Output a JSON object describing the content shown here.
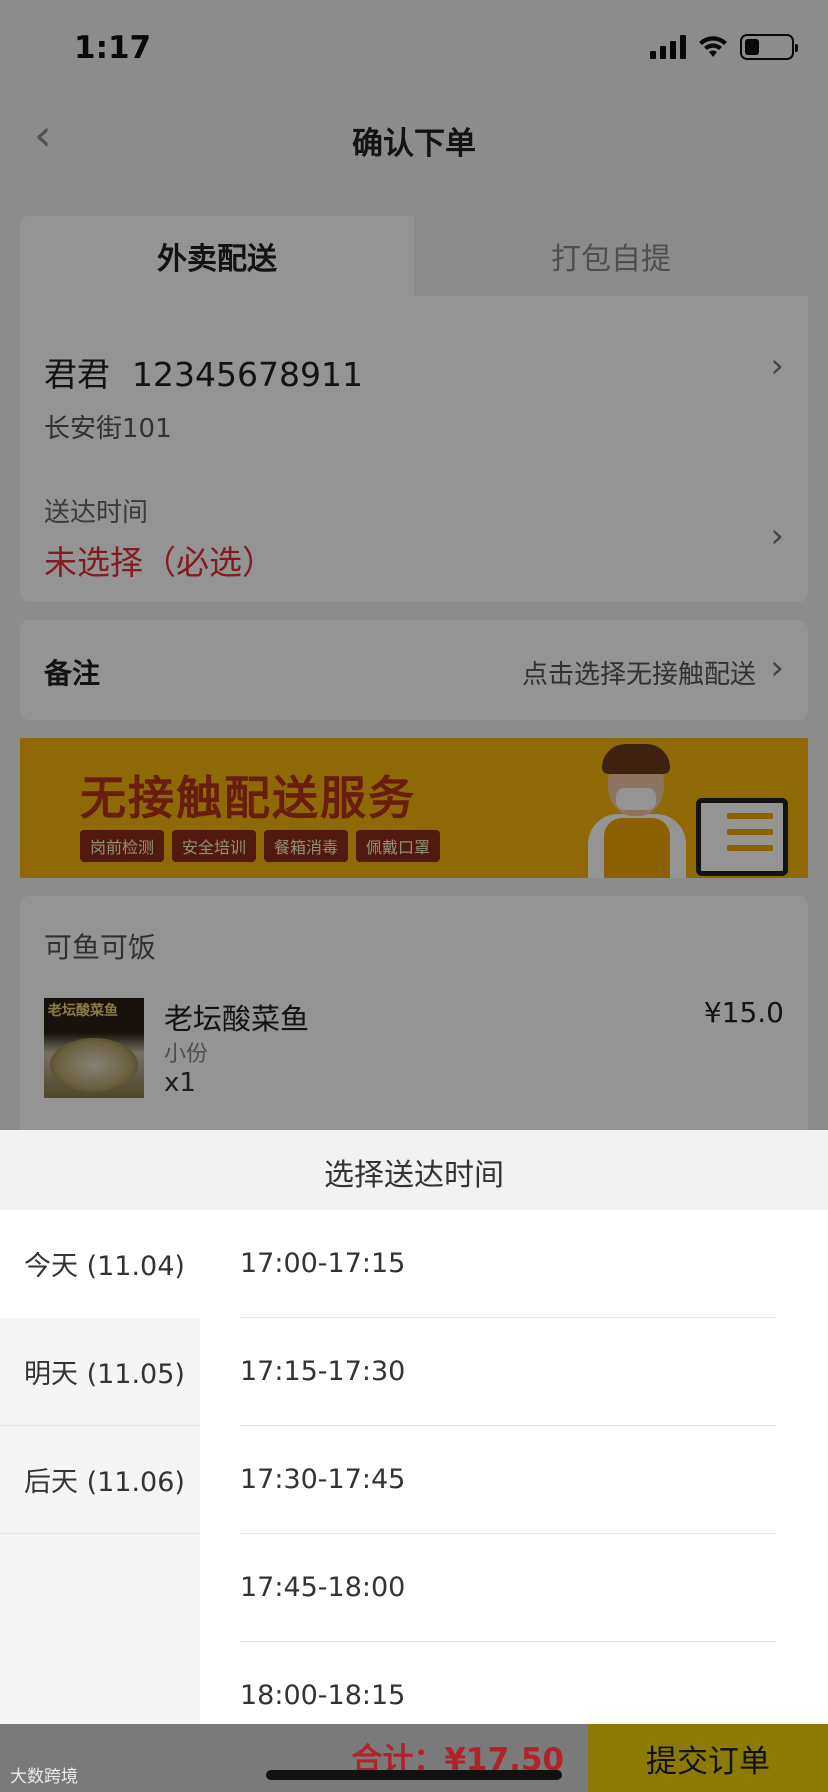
{
  "status_bar": {
    "time": "1:17"
  },
  "nav": {
    "back": "‹",
    "title": "确认下单"
  },
  "tabs": [
    {
      "label": "外卖配送"
    },
    {
      "label": "打包自提"
    }
  ],
  "address": {
    "name": "君君",
    "phone": "12345678911",
    "street": "长安街101",
    "delivery_label": "送达时间",
    "delivery_value": "未选择（必选）"
  },
  "note": {
    "label": "备注",
    "hint": "点击选择无接触配送"
  },
  "banner": {
    "headline": "无接触配送服务",
    "chips": [
      "岗前检测",
      "安全培训",
      "餐箱消毒",
      "佩戴口罩"
    ]
  },
  "shop": {
    "name": "可鱼可饭",
    "dish": {
      "image_text": "老坛酸菜鱼",
      "name": "老坛酸菜鱼",
      "spec": "小份",
      "qty": "x1",
      "price": "¥15.0"
    }
  },
  "sheet": {
    "title": "选择送达时间",
    "days": [
      "今天 (11.04)",
      "明天 (11.05)",
      "后天 (11.06)"
    ],
    "slots": [
      "17:00-17:15",
      "17:15-17:30",
      "17:30-17:45",
      "17:45-18:00",
      "18:00-18:15"
    ]
  },
  "footer": {
    "total": "合计：¥17.50",
    "submit": "提交订单",
    "watermark": "大数跨境"
  },
  "colors": {
    "accent": "#f4b50c",
    "required": "#e0313b"
  }
}
